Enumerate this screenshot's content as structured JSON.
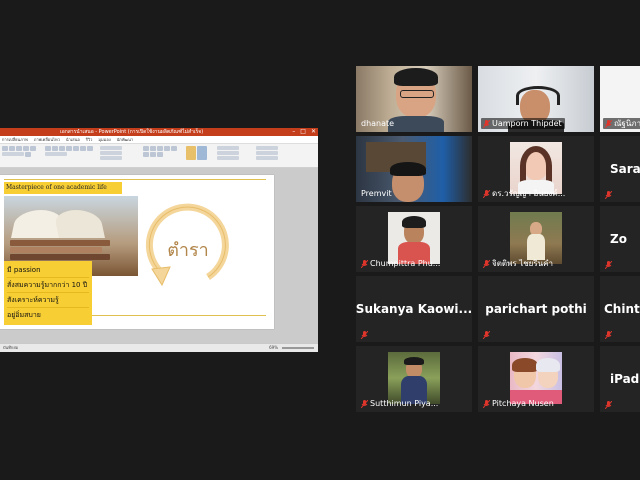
{
  "share": {
    "ppt_title": "เอกสารนำเสนอ - PowerPoint (การเปิดใช้งานผลิตภัณฑ์ไม่สำเร็จ)",
    "window_controls": [
      "–",
      "□",
      "✕"
    ],
    "tabs": [
      "การเปลี่ยนภาพ",
      "ภาพเคลื่อนไหว",
      "นำเสนอ",
      "รีวิว",
      "มุมมอง",
      "นักพัฒนา"
    ],
    "status_left": "บันทึกย่อ",
    "zoom": "69%",
    "slide": {
      "heading": "Masterpiece of  one academic life",
      "cycle_word": "ตำรา",
      "bullets": [
        "มี passion",
        "สั่งสมความรู้มากกว่า 10 ปี",
        "สังเคราะห์ความรู้",
        "อยู่อิ่มสบาย"
      ]
    }
  },
  "participants": [
    {
      "name": "dhanate",
      "muted": false,
      "video": true,
      "active": true
    },
    {
      "name": "Uamporn Thipdet",
      "muted": true,
      "video": true
    },
    {
      "name": "ณัฐนิภา",
      "muted": true,
      "video": true
    },
    {
      "name": "Premvit",
      "muted": false,
      "video": true
    },
    {
      "name": "ดร.วรัญญา อินยงค์...",
      "muted": true,
      "video": true
    },
    {
      "name": "Saraw",
      "muted": true,
      "video": false
    },
    {
      "name": "Chumpittra Phu...",
      "muted": true,
      "video": true
    },
    {
      "name": "จิตติพร ไชยรินคำ",
      "muted": true,
      "video": true
    },
    {
      "name": "Zo",
      "muted": true,
      "video": false
    },
    {
      "name": "Sukanya  Kaowi...",
      "muted": true,
      "video": false
    },
    {
      "name": "parichart pothi",
      "muted": true,
      "video": false
    },
    {
      "name": "Chinta",
      "muted": true,
      "video": false
    },
    {
      "name": "Sutthimun Piya...",
      "muted": true,
      "video": true
    },
    {
      "name": "Pitchaya Nusen",
      "muted": true,
      "video": true
    },
    {
      "name": "iPad",
      "muted": true,
      "video": false
    }
  ],
  "colors": {
    "active_border": "#9cd14a",
    "muted_icon": "#e0352b",
    "slide_accent": "#f7ce34"
  }
}
